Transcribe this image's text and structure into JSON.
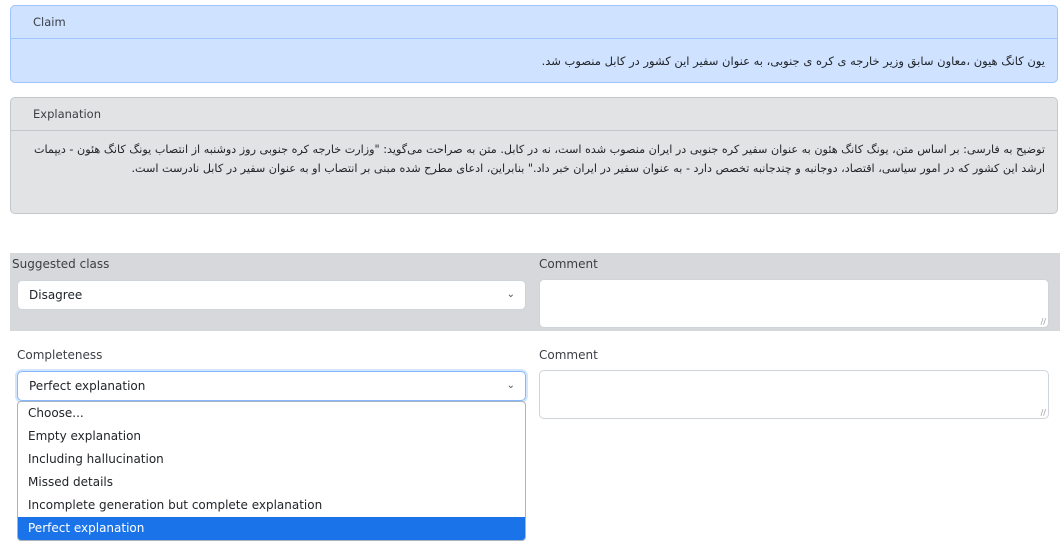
{
  "claim": {
    "header": "Claim",
    "text": "یون کانگ هیون ،معاون سابق وزیر خارجه ی کره ی جنوبی، به عنوان سفیر این کشور در کابل منصوب شد."
  },
  "explanation": {
    "header": "Explanation",
    "text": "توضیح به فارسی: بر اساس متن، یونگ کانگ هئون به عنوان سفیر کره جنوبی در ایران منصوب شده است، نه در کابل. متن به صراحت می‌گوید: \"وزارت خارجه کره جنوبی روز دوشنبه از انتصاب یونگ کانگ هئون - دیپمات ارشد این کشور که در امور سیاسی، اقتصاد، دوجانبه و چندجانبه تخصص دارد - به عنوان سفیر در ایران خبر داد.\" بنابراین، ادعای مطرح شده مبنی بر انتصاب او به عنوان سفیر در کابل نادرست است."
  },
  "suggested_class": {
    "label": "Suggested class",
    "value": "Disagree",
    "comment_label": "Comment"
  },
  "completeness": {
    "label": "Completeness",
    "value": "Perfect explanation",
    "comment_label": "Comment",
    "options": [
      "Choose...",
      "Empty explanation",
      "Including hallucination",
      "Missed details",
      "Incomplete generation but complete explanation",
      "Perfect explanation"
    ],
    "selected_index": 5
  },
  "icons": {
    "chevron": "chevron-down-icon",
    "resize": "resize-grip-icon"
  }
}
